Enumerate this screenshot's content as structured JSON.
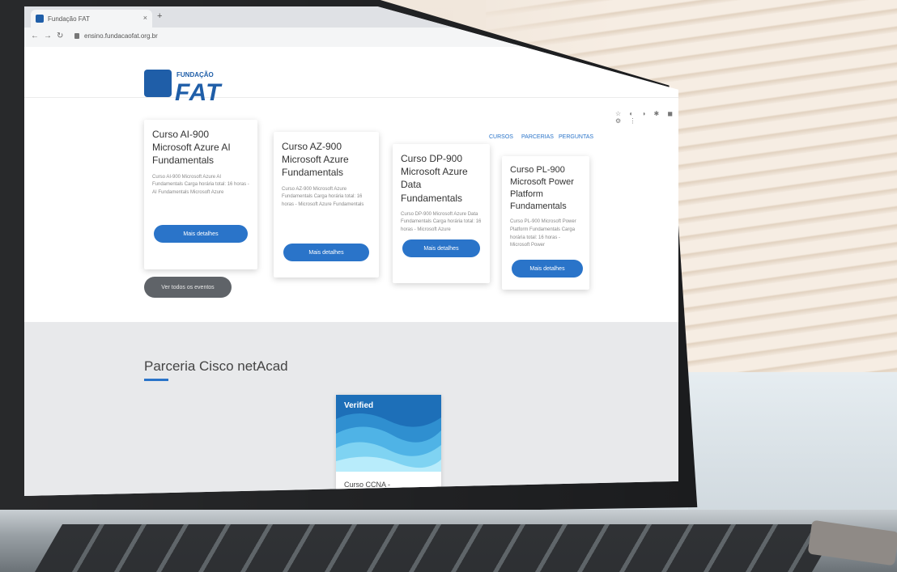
{
  "browser": {
    "tab_title": "Fundação FAT",
    "url": "ensino.fundacaofat.org.br",
    "new_tab_symbol": "+",
    "close_symbol": "×",
    "back_symbol": "←",
    "forward_symbol": "→",
    "reload_symbol": "↻",
    "toolbar_icons": "☆ ◐ ◑ ✱ ◼ ⚙ ⋮"
  },
  "site": {
    "logo_subtitle": "FUNDAÇÃO",
    "logo_text": "FAT",
    "nav": [
      "CURSOS",
      "PARCERIAS",
      "PERGUNTAS"
    ],
    "brand_color": "#1f5ea8",
    "accent_color": "#2a74c9"
  },
  "courses": [
    {
      "title": "Curso AI-900 Microsoft Azure AI Fundamentals",
      "desc": "Curso AI-900 Microsoft Azure AI Fundamentals Carga horária total: 16 horas - AI Fundamentals Microsoft Azure",
      "button": "Mais detalhes"
    },
    {
      "title": "Curso AZ-900 Microsoft Azure Fundamentals",
      "desc": "Curso AZ-900 Microsoft Azure Fundamentals Carga horária total: 16 horas - Microsoft Azure Fundamentals",
      "button": "Mais detalhes"
    },
    {
      "title": "Curso DP-900 Microsoft Azure Data Fundamentals",
      "desc": "Curso DP-900 Microsoft Azure Data Fundamentals Carga horária total: 16 horas - Microsoft Azure",
      "button": "Mais detalhes"
    },
    {
      "title": "Curso PL-900 Microsoft Power Platform Fundamentals",
      "desc": "Curso PL-900 Microsoft Power Platform Fundamentals Carga horária total: 16 horas - Microsoft Power",
      "button": "Mais detalhes"
    }
  ],
  "see_all_button": "Ver todos os eventos",
  "partnership": {
    "title": "Parceria Cisco netAcad",
    "badge_label": "Verified",
    "course_title": "Curso CCNA -"
  }
}
